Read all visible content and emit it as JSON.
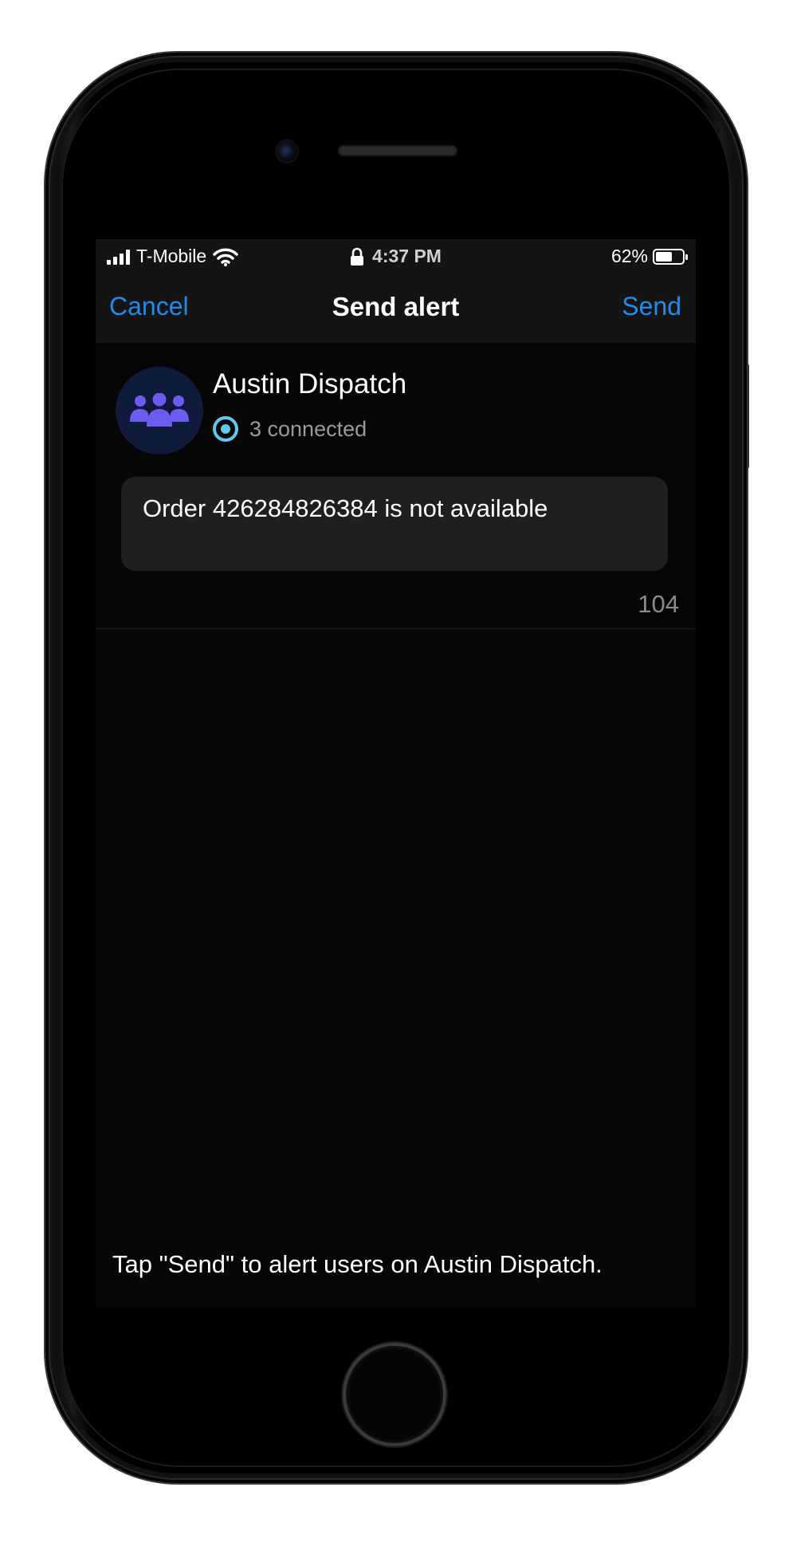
{
  "status_bar": {
    "carrier": "T-Mobile",
    "time": "4:37 PM",
    "battery_percent": "62%",
    "battery_level": 0.62
  },
  "nav": {
    "cancel_label": "Cancel",
    "title": "Send alert",
    "send_label": "Send"
  },
  "group": {
    "name": "Austin Dispatch",
    "connected_text": "3 connected",
    "avatar_icon": "group-icon"
  },
  "message": {
    "text": "Order 426284826384 is not available",
    "char_count": "104"
  },
  "footer": {
    "hint": "Tap \"Send\" to alert users on Austin Dispatch."
  },
  "colors": {
    "accent": "#1f8cf0",
    "avatar_bg": "#0f1b3a",
    "avatar_icon": "#6a5df0",
    "status_icon": "#5fc9f0"
  }
}
